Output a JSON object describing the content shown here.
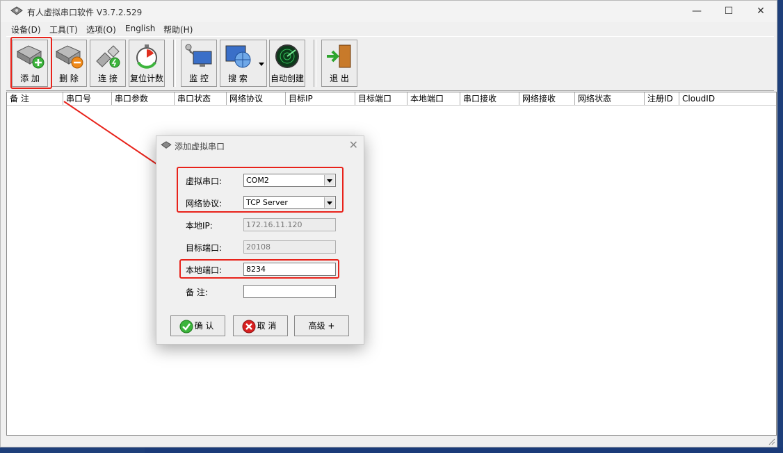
{
  "window": {
    "title": "有人虚拟串口软件 V3.7.2.529"
  },
  "menu": [
    "设备(D)",
    "工具(T)",
    "选项(O)",
    "English",
    "帮助(H)"
  ],
  "toolbar": {
    "add": "添 加",
    "delete": "删 除",
    "connect": "连 接",
    "reset": "复位计数",
    "monitor": "监 控",
    "search": "搜 索",
    "auto_create": "自动创建",
    "exit": "退 出"
  },
  "table": {
    "columns": [
      "备 注",
      "串口号",
      "串口参数",
      "串口状态",
      "网络协议",
      "目标IP",
      "目标端口",
      "本地端口",
      "串口接收",
      "网络接收",
      "网络状态",
      "注册ID",
      "CloudID"
    ]
  },
  "dialog": {
    "title": "添加虚拟串口",
    "virtual_port_label": "虚拟串口:",
    "virtual_port_value": "COM2",
    "protocol_label": "网络协议:",
    "protocol_value": "TCP Server",
    "local_ip_label": "本地IP:",
    "local_ip_value": "172.16.11.120",
    "target_port_label": "目标端口:",
    "target_port_value": "20108",
    "local_port_label": "本地端口:",
    "local_port_value": "8234",
    "remark_label": "备  注:",
    "remark_value": "",
    "ok": "确 认",
    "cancel": "取 消",
    "advanced": "高级 +"
  },
  "colors": {
    "highlight": "#e8221a",
    "arrow": "#e8221a"
  }
}
